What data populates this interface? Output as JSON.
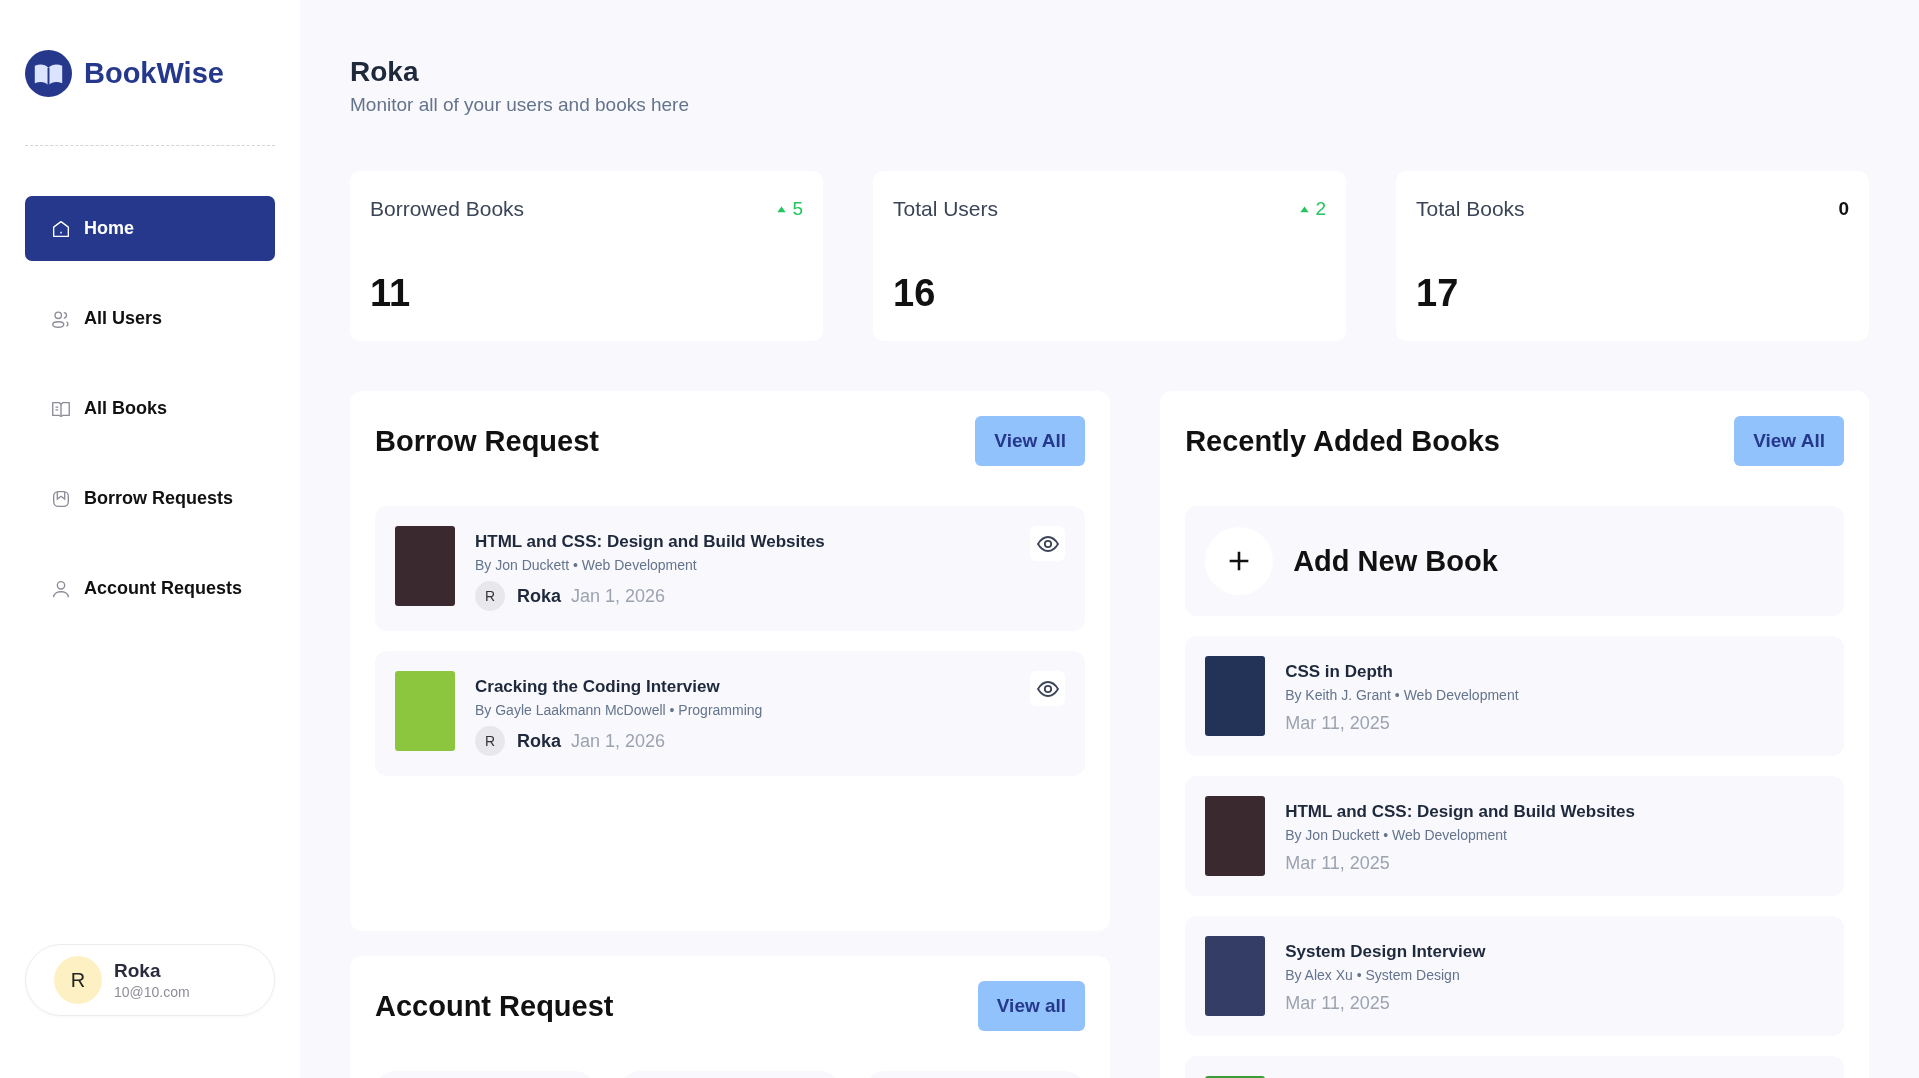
{
  "sidebar": {
    "brand": "BookWise",
    "items": [
      {
        "label": "Home",
        "selected": true
      },
      {
        "label": "All Users",
        "selected": false
      },
      {
        "label": "All Books",
        "selected": false
      },
      {
        "label": "Borrow Requests",
        "selected": false
      },
      {
        "label": "Account Requests",
        "selected": false
      }
    ],
    "user": {
      "initial": "R",
      "name": "Roka",
      "email": "10@10.com"
    }
  },
  "header": {
    "title": "Roka",
    "subtitle": "Monitor all of your users and books here"
  },
  "stats": [
    {
      "label": "Borrowed Books",
      "change": "5",
      "rising": true,
      "value": "11"
    },
    {
      "label": "Total Users",
      "change": "2",
      "rising": true,
      "value": "16"
    },
    {
      "label": "Total Books",
      "change": "0",
      "rising": false,
      "value": "17"
    }
  ],
  "borrow_requests": {
    "title": "Borrow Request",
    "button": "View All",
    "items": [
      {
        "title": "HTML and CSS: Design and Build Websites",
        "meta": "By Jon Duckett • Web Development",
        "initial": "R",
        "user": "Roka",
        "date": "Jan 1, 2026",
        "color": "#3a2a30"
      },
      {
        "title": "Cracking the Coding Interview",
        "meta": "By Gayle Laakmann McDowell • Programming",
        "initial": "R",
        "user": "Roka",
        "date": "Jan 1, 2026",
        "color": "#8cc63f"
      }
    ]
  },
  "account_requests": {
    "title": "Account Request",
    "button": "View all",
    "items": [
      {
        "kind": "card"
      },
      {
        "kind": "card"
      },
      {
        "kind": "card"
      }
    ]
  },
  "recent_books": {
    "title": "Recently Added Books",
    "button": "View All",
    "add_label": "Add New Book",
    "items": [
      {
        "title": "CSS in Depth",
        "meta": "By Keith J. Grant • Web Development",
        "date": "Mar 11, 2025",
        "color": "#233357"
      },
      {
        "title": "HTML and CSS: Design and Build Websites",
        "meta": "By Jon Duckett • Web Development",
        "date": "Mar 11, 2025",
        "color": "#3a2a30"
      },
      {
        "title": "System Design Interview",
        "meta": "By Alex Xu • System Design",
        "date": "Mar 11, 2025",
        "color": "#343d66"
      },
      {
        "color": "#3a9d3a"
      }
    ]
  }
}
